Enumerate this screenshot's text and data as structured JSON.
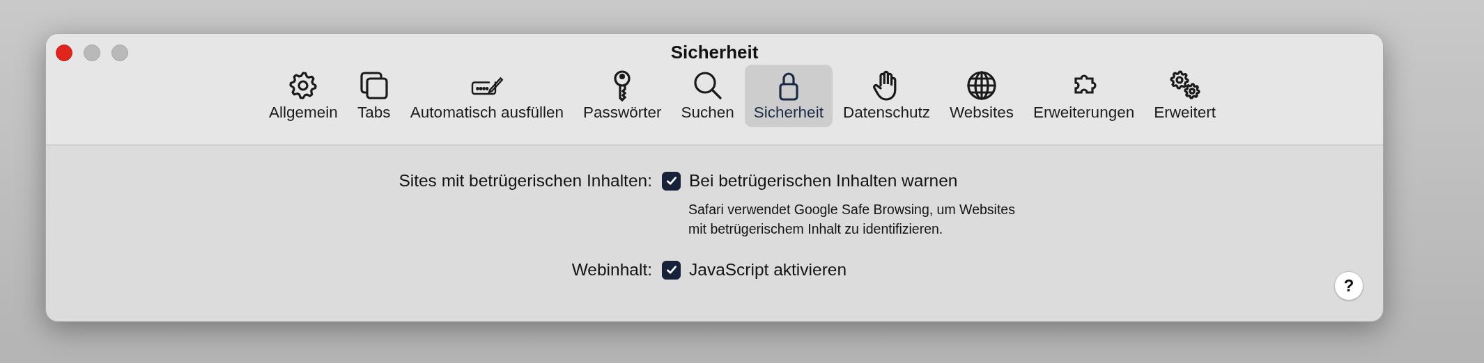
{
  "window": {
    "title": "Sicherheit"
  },
  "tabs": [
    {
      "label": "Allgemein",
      "selected": false
    },
    {
      "label": "Tabs",
      "selected": false
    },
    {
      "label": "Automatisch ausfüllen",
      "selected": false
    },
    {
      "label": "Passwörter",
      "selected": false
    },
    {
      "label": "Suchen",
      "selected": false
    },
    {
      "label": "Sicherheit",
      "selected": true
    },
    {
      "label": "Datenschutz",
      "selected": false
    },
    {
      "label": "Websites",
      "selected": false
    },
    {
      "label": "Erweiterungen",
      "selected": false
    },
    {
      "label": "Erweitert",
      "selected": false
    }
  ],
  "settings": [
    {
      "label": "Sites mit betrügerischen Inhalten:",
      "option": "Bei betrügerischen Inhalten warnen",
      "checked": true,
      "description": "Safari verwendet Google Safe Browsing, um Websites mit betrügerischem Inhalt zu identifizieren."
    },
    {
      "label": "Webinhalt:",
      "option": "JavaScript aktivieren",
      "checked": true
    }
  ],
  "help": {
    "label": "?"
  }
}
